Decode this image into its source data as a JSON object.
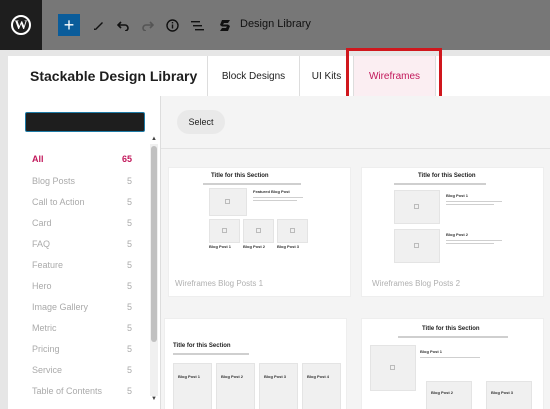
{
  "toolbar": {
    "logo_letter": "W",
    "add_symbol": "+",
    "design_library_label": "Design Library"
  },
  "modal": {
    "title": "Stackable Design Library",
    "tabs": [
      {
        "label": "Block Designs"
      },
      {
        "label": "UI Kits"
      },
      {
        "label": "Wireframes"
      }
    ],
    "active_tab": "Wireframes"
  },
  "sidebar": {
    "categories": [
      {
        "name": "All",
        "count": "65"
      },
      {
        "name": "Blog Posts",
        "count": "5"
      },
      {
        "name": "Call to Action",
        "count": "5"
      },
      {
        "name": "Card",
        "count": "5"
      },
      {
        "name": "FAQ",
        "count": "5"
      },
      {
        "name": "Feature",
        "count": "5"
      },
      {
        "name": "Hero",
        "count": "5"
      },
      {
        "name": "Image Gallery",
        "count": "5"
      },
      {
        "name": "Metric",
        "count": "5"
      },
      {
        "name": "Pricing",
        "count": "5"
      },
      {
        "name": "Service",
        "count": "5"
      },
      {
        "name": "Table of Contents",
        "count": "5"
      }
    ]
  },
  "content": {
    "select_label": "Select",
    "cards": [
      {
        "name": "Wireframes Blog Posts 1",
        "heading": "Title for this Section",
        "featured": "Featured Blog Post",
        "posts": [
          "Blog Post 1",
          "Blog Post 2",
          "Blog Post 3"
        ]
      },
      {
        "name": "Wireframes Blog Posts 2",
        "heading": "Title for this Section",
        "posts": [
          "Blog Post 1",
          "Blog Post 2"
        ]
      },
      {
        "heading": "Title for this Section",
        "posts": [
          "Blog Post 1",
          "Blog Post 2",
          "Blog Post 3",
          "Blog Post 4"
        ]
      },
      {
        "heading": "Title for this Section",
        "featured": "Blog Post 1",
        "posts": [
          "Blog Post 2",
          "Blog Post 3"
        ]
      }
    ]
  },
  "colors": {
    "accent": "#c2185b",
    "highlight_box": "#d0171d",
    "wp_blue": "#0a5c9a"
  }
}
